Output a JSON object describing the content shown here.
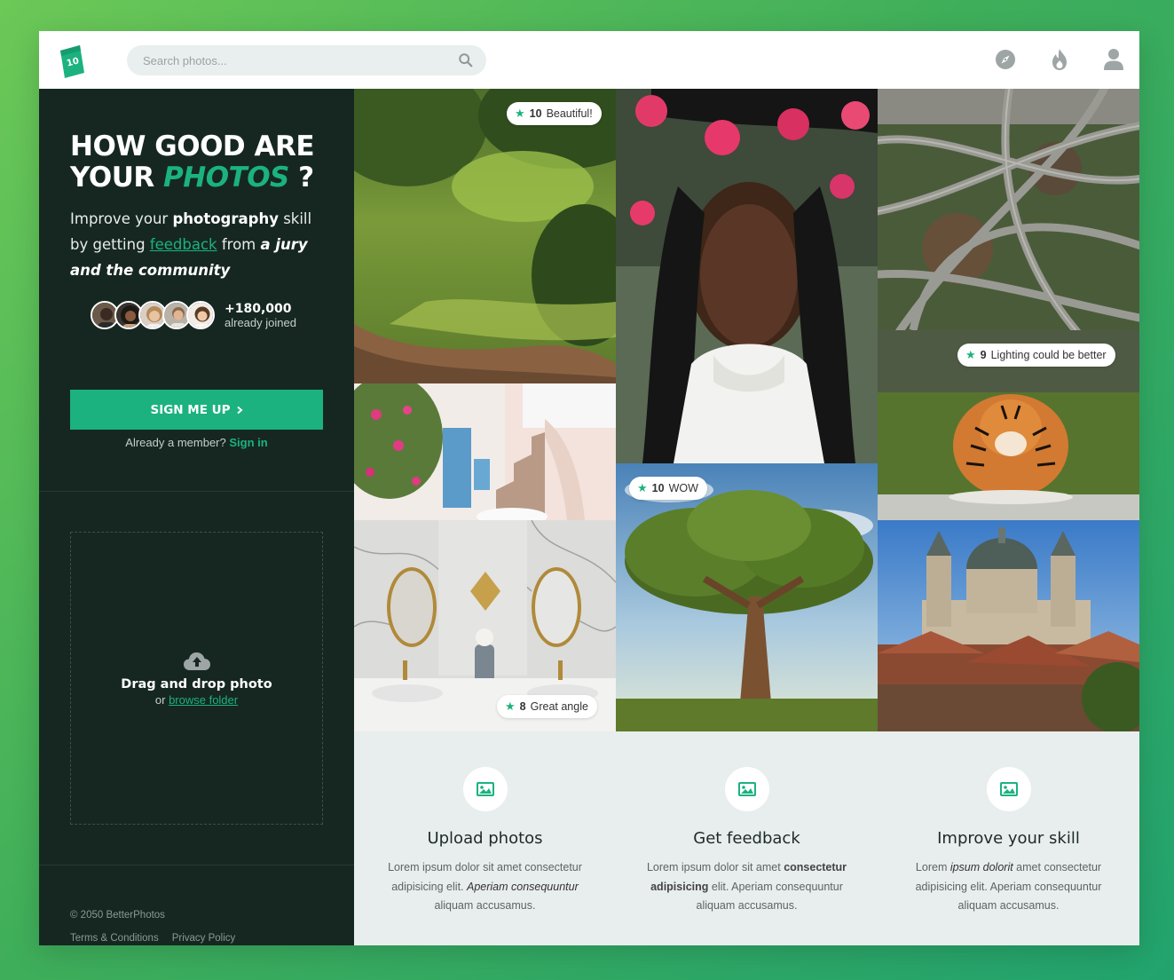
{
  "header": {
    "logo_text": "10",
    "search_placeholder": "Search photos...",
    "icons": [
      "compass-icon",
      "fire-icon",
      "user-icon"
    ]
  },
  "sidebar": {
    "headline_line1": "HOW GOOD ARE",
    "headline_your": "YOUR ",
    "headline_photos": "PHOTOS",
    "headline_q": " ?",
    "intro_pre": "Improve your ",
    "intro_bold": "photography",
    "intro_mid": " skill by getting ",
    "intro_link": "feedback",
    "intro_from": " from ",
    "intro_italic": "a jury and the community",
    "joined_count": "+180,000",
    "joined_label": "already joined",
    "signup_label": "SIGN ME UP",
    "member_text": "Already a member? ",
    "signin_label": "Sign in",
    "drop_title": "Drag and drop photo",
    "drop_or": "or ",
    "drop_link": "browse folder",
    "copyright": "© 2050 BetterPhotos",
    "terms": "Terms & Conditions",
    "privacy": "Privacy Policy"
  },
  "photos": [
    {
      "name": "photo-meadow-path",
      "score": "10",
      "comment": "Beautiful!"
    },
    {
      "name": "photo-portrait-flowers"
    },
    {
      "name": "photo-highway-interchange"
    },
    {
      "name": "photo-santorini-stairs"
    },
    {
      "name": "photo-tiger",
      "score": "9",
      "comment": "Lighting could be better"
    },
    {
      "name": "photo-marble-bathroom",
      "score": "8",
      "comment": "Great angle"
    },
    {
      "name": "photo-lone-tree",
      "score": "10",
      "comment": "WOW"
    },
    {
      "name": "photo-budapest-basilica"
    }
  ],
  "features": [
    {
      "title": "Upload photos",
      "d1": "Lorem ipsum dolor sit amet consectetur adipisicing elit. ",
      "d2": "Aperiam consequuntur",
      "d3": " aliquam accusamus."
    },
    {
      "title": "Get feedback",
      "d1": "Lorem ipsum dolor sit amet ",
      "d2": "consectetur adipisicing",
      "d3": " elit. Aperiam consequuntur aliquam accusamus."
    },
    {
      "title": "Improve your skill",
      "d1": "Lorem ",
      "d2": "ipsum dolorit",
      "d3": " amet consectetur adipisicing elit. Aperiam consequuntur aliquam accusamus."
    }
  ],
  "colors": {
    "accent": "#1bb27f",
    "sidebar_bg": "#162722",
    "features_bg": "#e8eded"
  }
}
